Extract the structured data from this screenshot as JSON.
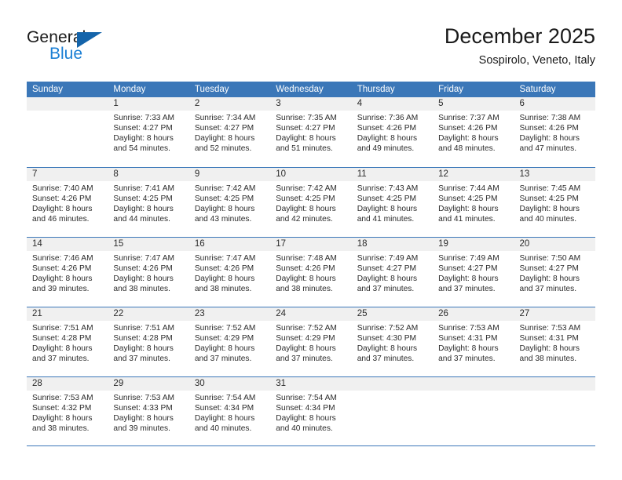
{
  "brand": {
    "name_top": "General",
    "name_bottom": "Blue",
    "accent_color": "#1464aa",
    "blue_text_color": "#1b7fd4"
  },
  "header": {
    "title": "December 2025",
    "subtitle": "Sospirolo, Veneto, Italy"
  },
  "theme": {
    "header_bg": "#3b77b8",
    "header_text": "#ffffff",
    "daynum_bg": "#f0f0f0",
    "cell_bg": "#ffffff",
    "grid_line": "#3b77b8",
    "text": "#2b2b2b"
  },
  "weekdays": [
    "Sunday",
    "Monday",
    "Tuesday",
    "Wednesday",
    "Thursday",
    "Friday",
    "Saturday"
  ],
  "weeks": [
    [
      {
        "day": "",
        "sunrise": "",
        "sunset": "",
        "daylight_1": "",
        "daylight_2": ""
      },
      {
        "day": "1",
        "sunrise": "Sunrise: 7:33 AM",
        "sunset": "Sunset: 4:27 PM",
        "daylight_1": "Daylight: 8 hours",
        "daylight_2": "and 54 minutes."
      },
      {
        "day": "2",
        "sunrise": "Sunrise: 7:34 AM",
        "sunset": "Sunset: 4:27 PM",
        "daylight_1": "Daylight: 8 hours",
        "daylight_2": "and 52 minutes."
      },
      {
        "day": "3",
        "sunrise": "Sunrise: 7:35 AM",
        "sunset": "Sunset: 4:27 PM",
        "daylight_1": "Daylight: 8 hours",
        "daylight_2": "and 51 minutes."
      },
      {
        "day": "4",
        "sunrise": "Sunrise: 7:36 AM",
        "sunset": "Sunset: 4:26 PM",
        "daylight_1": "Daylight: 8 hours",
        "daylight_2": "and 49 minutes."
      },
      {
        "day": "5",
        "sunrise": "Sunrise: 7:37 AM",
        "sunset": "Sunset: 4:26 PM",
        "daylight_1": "Daylight: 8 hours",
        "daylight_2": "and 48 minutes."
      },
      {
        "day": "6",
        "sunrise": "Sunrise: 7:38 AM",
        "sunset": "Sunset: 4:26 PM",
        "daylight_1": "Daylight: 8 hours",
        "daylight_2": "and 47 minutes."
      }
    ],
    [
      {
        "day": "7",
        "sunrise": "Sunrise: 7:40 AM",
        "sunset": "Sunset: 4:26 PM",
        "daylight_1": "Daylight: 8 hours",
        "daylight_2": "and 46 minutes."
      },
      {
        "day": "8",
        "sunrise": "Sunrise: 7:41 AM",
        "sunset": "Sunset: 4:25 PM",
        "daylight_1": "Daylight: 8 hours",
        "daylight_2": "and 44 minutes."
      },
      {
        "day": "9",
        "sunrise": "Sunrise: 7:42 AM",
        "sunset": "Sunset: 4:25 PM",
        "daylight_1": "Daylight: 8 hours",
        "daylight_2": "and 43 minutes."
      },
      {
        "day": "10",
        "sunrise": "Sunrise: 7:42 AM",
        "sunset": "Sunset: 4:25 PM",
        "daylight_1": "Daylight: 8 hours",
        "daylight_2": "and 42 minutes."
      },
      {
        "day": "11",
        "sunrise": "Sunrise: 7:43 AM",
        "sunset": "Sunset: 4:25 PM",
        "daylight_1": "Daylight: 8 hours",
        "daylight_2": "and 41 minutes."
      },
      {
        "day": "12",
        "sunrise": "Sunrise: 7:44 AM",
        "sunset": "Sunset: 4:25 PM",
        "daylight_1": "Daylight: 8 hours",
        "daylight_2": "and 41 minutes."
      },
      {
        "day": "13",
        "sunrise": "Sunrise: 7:45 AM",
        "sunset": "Sunset: 4:25 PM",
        "daylight_1": "Daylight: 8 hours",
        "daylight_2": "and 40 minutes."
      }
    ],
    [
      {
        "day": "14",
        "sunrise": "Sunrise: 7:46 AM",
        "sunset": "Sunset: 4:26 PM",
        "daylight_1": "Daylight: 8 hours",
        "daylight_2": "and 39 minutes."
      },
      {
        "day": "15",
        "sunrise": "Sunrise: 7:47 AM",
        "sunset": "Sunset: 4:26 PM",
        "daylight_1": "Daylight: 8 hours",
        "daylight_2": "and 38 minutes."
      },
      {
        "day": "16",
        "sunrise": "Sunrise: 7:47 AM",
        "sunset": "Sunset: 4:26 PM",
        "daylight_1": "Daylight: 8 hours",
        "daylight_2": "and 38 minutes."
      },
      {
        "day": "17",
        "sunrise": "Sunrise: 7:48 AM",
        "sunset": "Sunset: 4:26 PM",
        "daylight_1": "Daylight: 8 hours",
        "daylight_2": "and 38 minutes."
      },
      {
        "day": "18",
        "sunrise": "Sunrise: 7:49 AM",
        "sunset": "Sunset: 4:27 PM",
        "daylight_1": "Daylight: 8 hours",
        "daylight_2": "and 37 minutes."
      },
      {
        "day": "19",
        "sunrise": "Sunrise: 7:49 AM",
        "sunset": "Sunset: 4:27 PM",
        "daylight_1": "Daylight: 8 hours",
        "daylight_2": "and 37 minutes."
      },
      {
        "day": "20",
        "sunrise": "Sunrise: 7:50 AM",
        "sunset": "Sunset: 4:27 PM",
        "daylight_1": "Daylight: 8 hours",
        "daylight_2": "and 37 minutes."
      }
    ],
    [
      {
        "day": "21",
        "sunrise": "Sunrise: 7:51 AM",
        "sunset": "Sunset: 4:28 PM",
        "daylight_1": "Daylight: 8 hours",
        "daylight_2": "and 37 minutes."
      },
      {
        "day": "22",
        "sunrise": "Sunrise: 7:51 AM",
        "sunset": "Sunset: 4:28 PM",
        "daylight_1": "Daylight: 8 hours",
        "daylight_2": "and 37 minutes."
      },
      {
        "day": "23",
        "sunrise": "Sunrise: 7:52 AM",
        "sunset": "Sunset: 4:29 PM",
        "daylight_1": "Daylight: 8 hours",
        "daylight_2": "and 37 minutes."
      },
      {
        "day": "24",
        "sunrise": "Sunrise: 7:52 AM",
        "sunset": "Sunset: 4:29 PM",
        "daylight_1": "Daylight: 8 hours",
        "daylight_2": "and 37 minutes."
      },
      {
        "day": "25",
        "sunrise": "Sunrise: 7:52 AM",
        "sunset": "Sunset: 4:30 PM",
        "daylight_1": "Daylight: 8 hours",
        "daylight_2": "and 37 minutes."
      },
      {
        "day": "26",
        "sunrise": "Sunrise: 7:53 AM",
        "sunset": "Sunset: 4:31 PM",
        "daylight_1": "Daylight: 8 hours",
        "daylight_2": "and 37 minutes."
      },
      {
        "day": "27",
        "sunrise": "Sunrise: 7:53 AM",
        "sunset": "Sunset: 4:31 PM",
        "daylight_1": "Daylight: 8 hours",
        "daylight_2": "and 38 minutes."
      }
    ],
    [
      {
        "day": "28",
        "sunrise": "Sunrise: 7:53 AM",
        "sunset": "Sunset: 4:32 PM",
        "daylight_1": "Daylight: 8 hours",
        "daylight_2": "and 38 minutes."
      },
      {
        "day": "29",
        "sunrise": "Sunrise: 7:53 AM",
        "sunset": "Sunset: 4:33 PM",
        "daylight_1": "Daylight: 8 hours",
        "daylight_2": "and 39 minutes."
      },
      {
        "day": "30",
        "sunrise": "Sunrise: 7:54 AM",
        "sunset": "Sunset: 4:34 PM",
        "daylight_1": "Daylight: 8 hours",
        "daylight_2": "and 40 minutes."
      },
      {
        "day": "31",
        "sunrise": "Sunrise: 7:54 AM",
        "sunset": "Sunset: 4:34 PM",
        "daylight_1": "Daylight: 8 hours",
        "daylight_2": "and 40 minutes."
      },
      {
        "day": "",
        "sunrise": "",
        "sunset": "",
        "daylight_1": "",
        "daylight_2": ""
      },
      {
        "day": "",
        "sunrise": "",
        "sunset": "",
        "daylight_1": "",
        "daylight_2": ""
      },
      {
        "day": "",
        "sunrise": "",
        "sunset": "",
        "daylight_1": "",
        "daylight_2": ""
      }
    ]
  ]
}
